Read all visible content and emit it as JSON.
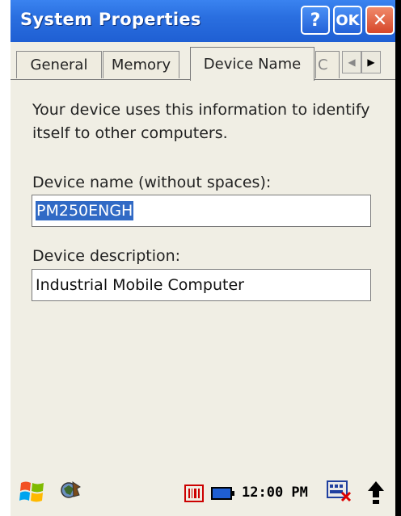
{
  "window": {
    "title": "System Properties",
    "help_label": "?",
    "ok_label": "OK",
    "close_label": "✕"
  },
  "tabs": [
    {
      "label": "General"
    },
    {
      "label": "Memory"
    },
    {
      "label": "Device Name"
    },
    {
      "label": "C"
    }
  ],
  "tab_scroll": {
    "left": "◀",
    "right": "▶"
  },
  "content": {
    "info_text": "Your device uses this information to identify itself to other computers.",
    "device_name_label": "Device name (without spaces):",
    "device_name_value": "PM250ENGH",
    "device_description_label": "Device description:",
    "device_description_value": "Industrial Mobile Computer"
  },
  "taskbar": {
    "clock": "12:00 PM",
    "icons": [
      "windows-start-icon",
      "connectivity-icon",
      "barcode-scanner-icon",
      "battery-icon",
      "keyboard-icon",
      "up-arrow-icon"
    ]
  },
  "colors": {
    "titlebar": "#2a6fe0",
    "selection": "#316ac5",
    "close_button": "#d6472a",
    "background": "#f0eee4"
  }
}
